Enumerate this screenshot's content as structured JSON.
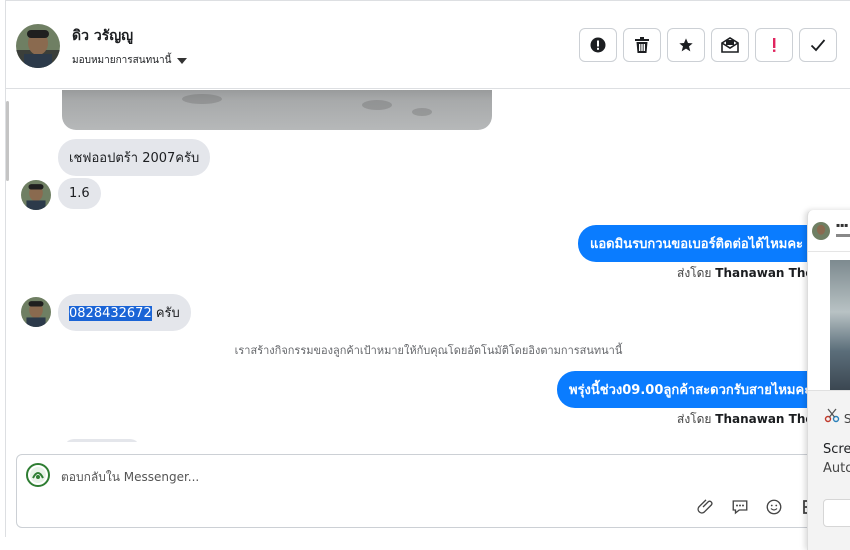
{
  "header": {
    "contact_name": "ดิว วรัญญู",
    "assign_label": "มอบหมายการสนทนานี้",
    "actions": [
      {
        "name": "report-icon",
        "glyph": "!"
      },
      {
        "name": "trash-icon",
        "glyph": "🗑"
      },
      {
        "name": "star-icon",
        "glyph": "★"
      },
      {
        "name": "mark-unread-icon",
        "glyph": "✉"
      },
      {
        "name": "important-icon",
        "glyph": "!"
      },
      {
        "name": "done-check-icon",
        "glyph": "✓"
      }
    ]
  },
  "messages": {
    "m1": "เชฟออปตร้า 2007ครับ",
    "m2": "1.6",
    "m3_out": "แอดมินรบกวนขอเบอร์ติดต่อได้ไหมคะ",
    "m3_sent_prefix": "ส่งโดย",
    "m3_sent_by": "Thanawan Thon",
    "m4_phone": "0828432672",
    "m4_suffix": " ครับ",
    "system_note": "เราสร้างกิจกรรมของลูกค้าเป้าหมายให้กับคุณโดยอัตโนมัติโดยอิงตามการสนทนานี้",
    "m5_out": "พรุ่งนี้ช่วง09.00ลูกค้าสะดวกรับสายไหมคะ",
    "m5_sent_prefix": "ส่งโดย",
    "m5_sent_by": "Thanawan Thon"
  },
  "composer": {
    "placeholder": "ตอบกลับใน Messenger..."
  },
  "overlay": {
    "snip_label": "S",
    "text1": "Scre",
    "text2": "Auto"
  },
  "colors": {
    "accent": "#0a7cff",
    "incoming_bubble": "#e4e6eb",
    "important": "#e0245e"
  }
}
